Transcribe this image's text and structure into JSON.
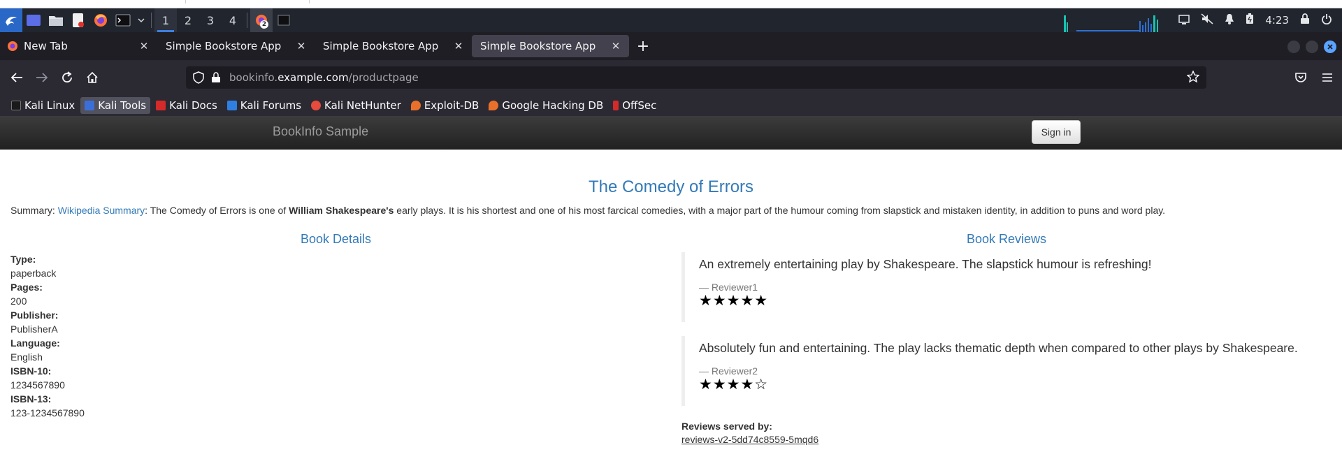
{
  "taskbar": {
    "workspaces": [
      "1",
      "2",
      "3",
      "4"
    ],
    "active_workspace": "1",
    "notification_count": "2",
    "clock": "4:23"
  },
  "browser": {
    "tabs": [
      {
        "label": "New Tab",
        "selected": false
      },
      {
        "label": "Simple Bookstore App",
        "selected": false
      },
      {
        "label": "Simple Bookstore App",
        "selected": false
      },
      {
        "label": "Simple Bookstore App",
        "selected": true
      }
    ],
    "url": {
      "host_prefix": "bookinfo.",
      "host_main": "example.com",
      "path": "/productpage"
    },
    "bookmarks": [
      {
        "label": "Kali Linux",
        "icon": "kali-dragon-icon",
        "color": "#1a1a1a"
      },
      {
        "label": "Kali Tools",
        "icon": "kali-tools-icon",
        "color": "#3b6fd8"
      },
      {
        "label": "Kali Docs",
        "icon": "kali-docs-icon",
        "color": "#d42a2a"
      },
      {
        "label": "Kali Forums",
        "icon": "kali-forums-icon",
        "color": "#2f7fe3"
      },
      {
        "label": "Kali NetHunter",
        "icon": "nethunter-icon",
        "color": "#e64b3c"
      },
      {
        "label": "Exploit-DB",
        "icon": "exploit-db-icon",
        "color": "#e8702a"
      },
      {
        "label": "Google Hacking DB",
        "icon": "ghdb-icon",
        "color": "#e8702a"
      },
      {
        "label": "OffSec",
        "icon": "offsec-icon",
        "color": "#d42a2a"
      }
    ]
  },
  "app": {
    "brand": "BookInfo Sample",
    "signin_label": "Sign in",
    "book_title": "The Comedy of Errors",
    "summary": {
      "prefix": "Summary: ",
      "link": "Wikipedia Summary",
      "part1": ": The Comedy of Errors is one of ",
      "bold": "William Shakespeare's",
      "part2": " early plays. It is his shortest and one of his most farcical comedies, with a major part of the humour coming from slapstick and mistaken identity, in addition to puns and word play."
    },
    "details_title": "Book Details",
    "details": {
      "type_label": "Type:",
      "type": "paperback",
      "pages_label": "Pages:",
      "pages": "200",
      "publisher_label": "Publisher:",
      "publisher": "PublisherA",
      "language_label": "Language:",
      "language": "English",
      "isbn10_label": "ISBN-10:",
      "isbn10": "1234567890",
      "isbn13_label": "ISBN-13:",
      "isbn13": "123-1234567890"
    },
    "reviews_title": "Book Reviews",
    "reviews": [
      {
        "text": "An extremely entertaining play by Shakespeare. The slapstick humour is refreshing!",
        "by": "— Reviewer1",
        "stars": "★★★★★",
        "rating": 5
      },
      {
        "text": "Absolutely fun and entertaining. The play lacks thematic depth when compared to other plays by Shakespeare.",
        "by": "— Reviewer2",
        "stars": "★★★★☆",
        "rating": 4
      }
    ],
    "served_by_label": "Reviews served by:",
    "served_by_pod": "reviews-v2-5dd74c8559-5mqd6"
  }
}
